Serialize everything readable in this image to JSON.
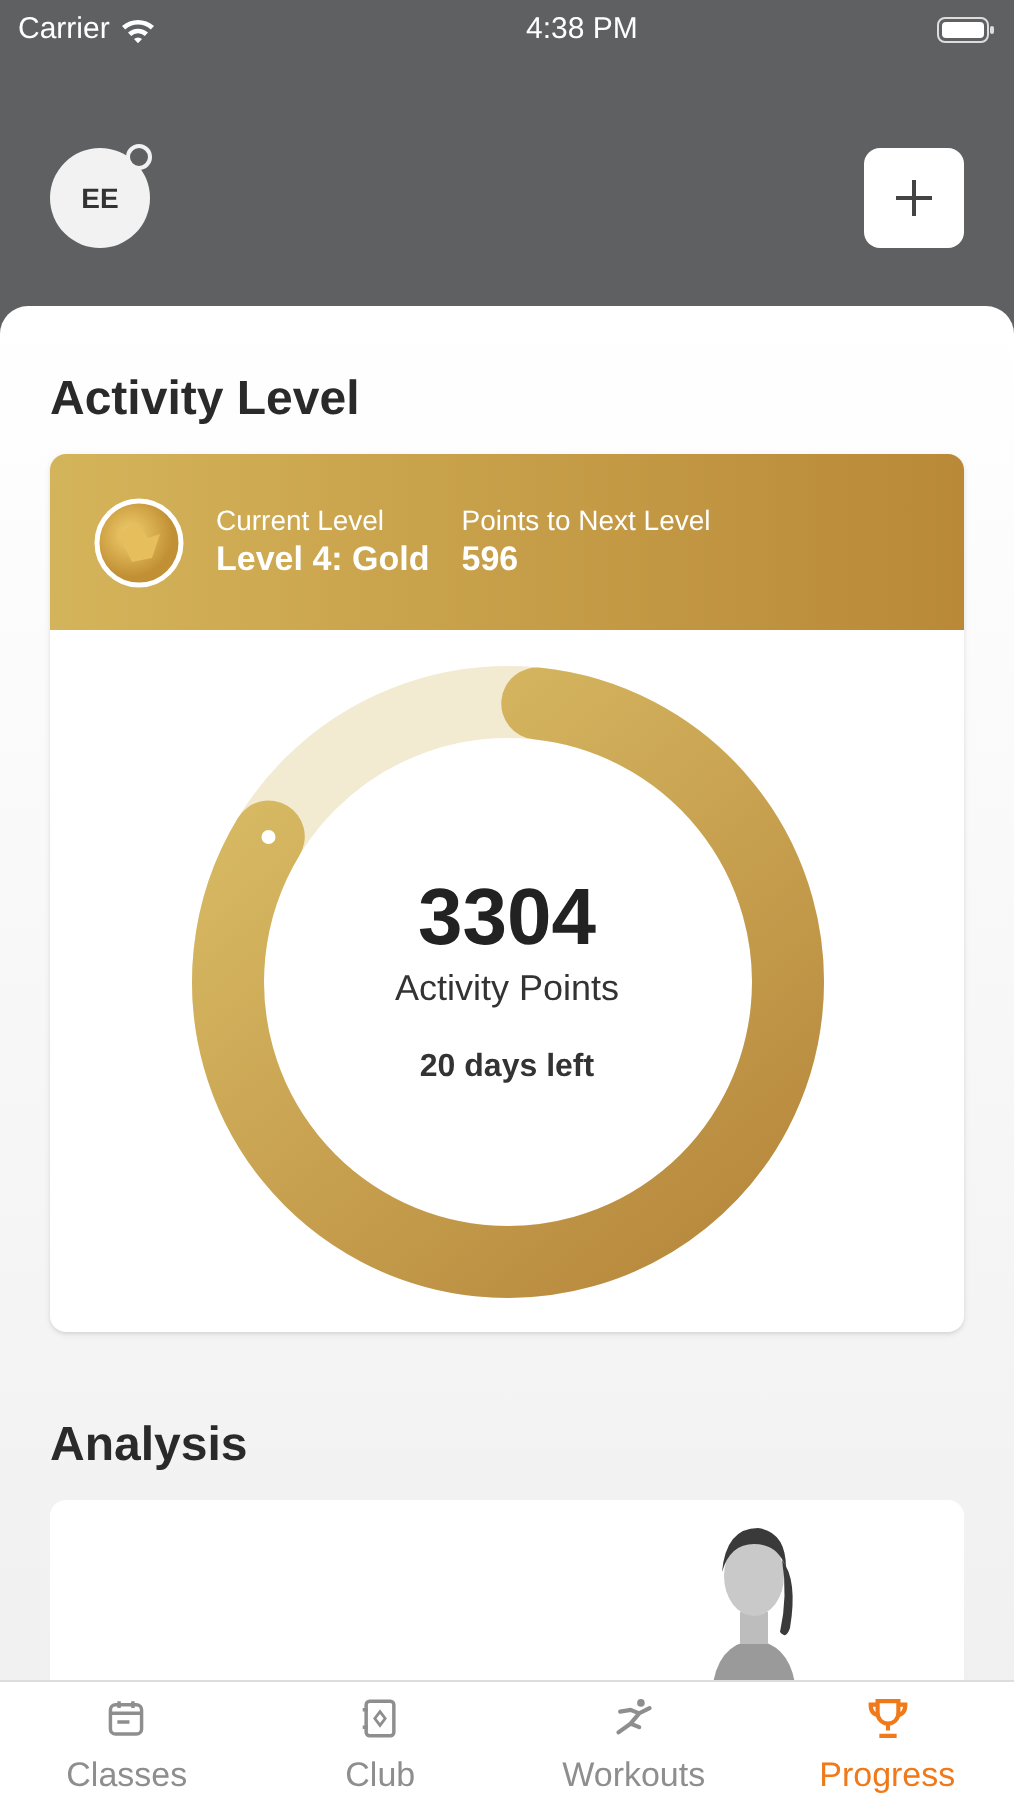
{
  "status_bar": {
    "carrier": "Carrier",
    "time": "4:38 PM"
  },
  "header": {
    "avatar_initials": "EE"
  },
  "activity": {
    "title": "Activity Level",
    "current_level_label": "Current Level",
    "current_level": "Level 4: Gold",
    "next_level_label": "Points to Next Level",
    "next_level_points": "596",
    "ring": {
      "level": 0.82,
      "points": "3304",
      "points_label": "Activity Points",
      "days_left": "20 days left"
    }
  },
  "analysis": {
    "title": "Analysis"
  },
  "tabs": [
    {
      "label": "Classes",
      "selected": false
    },
    {
      "label": "Club",
      "selected": false
    },
    {
      "label": "Workouts",
      "selected": false
    },
    {
      "label": "Progress",
      "selected": true
    }
  ]
}
